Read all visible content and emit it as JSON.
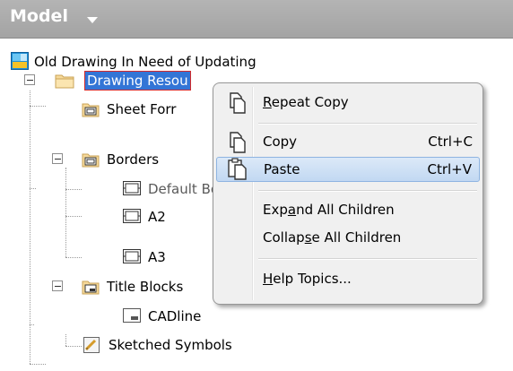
{
  "panel": {
    "title": "Model",
    "caret_icon": "chevron-down-icon"
  },
  "tree": {
    "root": {
      "label": "Old Drawing In Need of Updating",
      "icon": "drawing-document-icon"
    },
    "drawing_resources": {
      "label": "Drawing Resources",
      "visible_label": "Drawing Resou",
      "icon": "folder-icon"
    },
    "sheet_formats": {
      "label": "Sheet Forr",
      "icon": "sheet-format-icon"
    },
    "borders": {
      "label": "Borders",
      "icon": "border-folder-icon"
    },
    "default_border": {
      "label": "Default Border",
      "icon": "border-icon"
    },
    "a2": {
      "label": "A2",
      "icon": "border-icon"
    },
    "a3": {
      "label": "A3",
      "icon": "border-icon"
    },
    "title_blocks": {
      "label": "Title Blocks",
      "icon": "title-block-folder-icon"
    },
    "cadline": {
      "label": "CADline",
      "icon": "title-block-icon"
    },
    "sketched_symbols": {
      "label": "Sketched Symbols",
      "icon": "sketched-symbol-icon"
    }
  },
  "context_menu": {
    "items": [
      {
        "label": "Repeat Copy",
        "mnemonic": "R",
        "rest": "epeat Copy",
        "shortcut": "",
        "icon": "copy-icon"
      },
      {
        "label": "Copy",
        "shortcut": "Ctrl+C",
        "icon": "copy-icon"
      },
      {
        "label": "Paste",
        "shortcut": "Ctrl+V",
        "icon": "paste-icon",
        "highlighted": true
      },
      {
        "label": "Expand All Children",
        "pre": "Exp",
        "mnemonic": "a",
        "post": "nd All Children",
        "shortcut": ""
      },
      {
        "label": "Collapse All Children",
        "pre": "Collap",
        "mnemonic": "s",
        "post": "e All Children",
        "shortcut": ""
      },
      {
        "label": "Help Topics...",
        "mnemonic": "H",
        "rest": "elp Topics...",
        "shortcut": ""
      }
    ]
  },
  "colors": {
    "header_bg": "#a8a8a8",
    "selection_bg": "#3375d6",
    "selection_outline": "#d52a2a",
    "menu_highlight": "#c8dcf4"
  }
}
